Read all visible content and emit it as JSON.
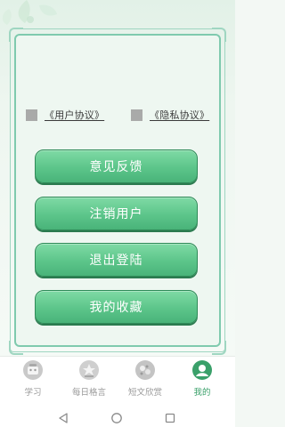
{
  "agreements": {
    "user_agreement": "《用户协议》",
    "privacy_agreement": "《隐私协议》"
  },
  "actions": {
    "feedback": "意见反馈",
    "cancel_account": "注销用户",
    "logout": "退出登陆",
    "favorites": "我的收藏"
  },
  "tabs": [
    {
      "label": "学习",
      "icon": "study-icon",
      "active": false
    },
    {
      "label": "每日格言",
      "icon": "motto-icon",
      "active": false
    },
    {
      "label": "短文欣赏",
      "icon": "essay-icon",
      "active": false
    },
    {
      "label": "我的",
      "icon": "profile-icon",
      "active": true
    }
  ],
  "colors": {
    "button_green": "#5cc58a",
    "frame_green": "#7fcaae",
    "active_tab": "#3aa06a"
  }
}
